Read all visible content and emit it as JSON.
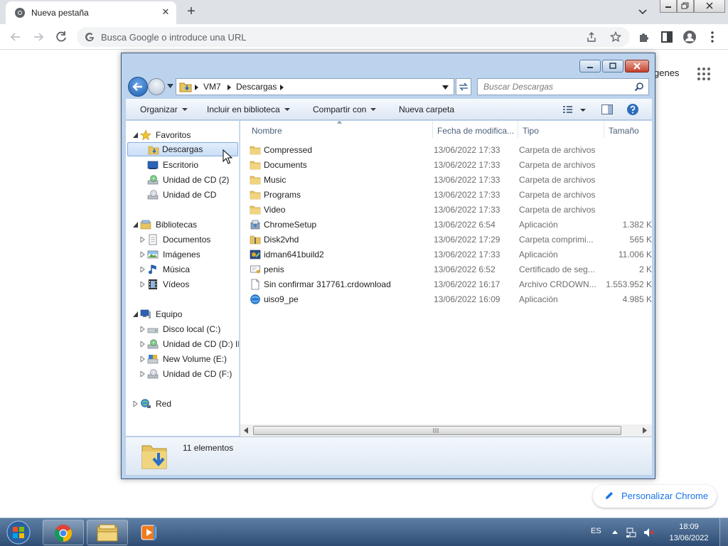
{
  "chrome": {
    "tab_title": "Nueva pestaña",
    "tab_close": "✕",
    "new_tab": "+",
    "omnibox_placeholder": "Busca Google o introduce una URL",
    "ntp_images": "genes",
    "customize_label": "Personalizar Chrome",
    "colors": {
      "tabbar": "#dee1e6",
      "accent": "#1a73e8"
    }
  },
  "explorer": {
    "breadcrumb": [
      "VM7",
      "Descargas"
    ],
    "search_placeholder": "Buscar Descargas",
    "commands": [
      {
        "label": "Organizar",
        "dropdown": true
      },
      {
        "label": "Incluir en biblioteca",
        "dropdown": true
      },
      {
        "label": "Compartir con",
        "dropdown": true
      },
      {
        "label": "Nueva carpeta",
        "dropdown": false
      }
    ],
    "nav": {
      "favorites": {
        "label": "Favoritos",
        "items": [
          {
            "label": "Descargas",
            "icon": "downloads-folder-icon",
            "selected": true
          },
          {
            "label": "Escritorio",
            "icon": "desktop-icon"
          },
          {
            "label": "Unidad de CD (2)",
            "icon": "cd-drive-icon"
          },
          {
            "label": "Unidad de CD",
            "icon": "cd-drive-icon"
          }
        ]
      },
      "libraries": {
        "label": "Bibliotecas",
        "items": [
          {
            "label": "Documentos",
            "icon": "documents-icon"
          },
          {
            "label": "Imágenes",
            "icon": "pictures-icon"
          },
          {
            "label": "Música",
            "icon": "music-icon"
          },
          {
            "label": "Vídeos",
            "icon": "videos-icon"
          }
        ]
      },
      "computer": {
        "label": "Equipo",
        "items": [
          {
            "label": "Disco local (C:)",
            "icon": "hard-disk-icon"
          },
          {
            "label": "Unidad de CD (D:) IF",
            "icon": "cd-drive-icon"
          },
          {
            "label": "New Volume (E:)",
            "icon": "volume-icon"
          },
          {
            "label": "Unidad de CD (F:)",
            "icon": "cd-drive-icon"
          }
        ]
      },
      "network": {
        "label": "Red"
      }
    },
    "columns": {
      "name": "Nombre",
      "date": "Fecha de modifica...",
      "type": "Tipo",
      "size": "Tamaño"
    },
    "files": [
      {
        "name": "Compressed",
        "date": "13/06/2022 17:33",
        "type": "Carpeta de archivos",
        "size": "",
        "icon": "folder-icon"
      },
      {
        "name": "Documents",
        "date": "13/06/2022 17:33",
        "type": "Carpeta de archivos",
        "size": "",
        "icon": "folder-icon"
      },
      {
        "name": "Music",
        "date": "13/06/2022 17:33",
        "type": "Carpeta de archivos",
        "size": "",
        "icon": "folder-icon"
      },
      {
        "name": "Programs",
        "date": "13/06/2022 17:33",
        "type": "Carpeta de archivos",
        "size": "",
        "icon": "folder-icon"
      },
      {
        "name": "Video",
        "date": "13/06/2022 17:33",
        "type": "Carpeta de archivos",
        "size": "",
        "icon": "folder-icon"
      },
      {
        "name": "ChromeSetup",
        "date": "13/06/2022 6:54",
        "type": "Aplicación",
        "size": "1.382 K",
        "icon": "installer-icon"
      },
      {
        "name": "Disk2vhd",
        "date": "13/06/2022 17:29",
        "type": "Carpeta comprimi...",
        "size": "565 K",
        "icon": "zip-folder-icon"
      },
      {
        "name": "idman641build2",
        "date": "13/06/2022 17:33",
        "type": "Aplicación",
        "size": "11.006 K",
        "icon": "application-icon"
      },
      {
        "name": "penis",
        "date": "13/06/2022 6:52",
        "type": "Certificado de seg...",
        "size": "2 K",
        "icon": "certificate-icon"
      },
      {
        "name": "Sin confirmar 317761.crdownload",
        "date": "13/06/2022 16:17",
        "type": "Archivo CRDOWN...",
        "size": "1.553.952 K",
        "icon": "file-icon"
      },
      {
        "name": "uiso9_pe",
        "date": "13/06/2022 16:09",
        "type": "Aplicación",
        "size": "4.985 K",
        "icon": "globe-app-icon"
      }
    ],
    "status_count": "11 elementos"
  },
  "taskbar": {
    "language": "ES",
    "time": "18:09",
    "date": "13/06/2022"
  }
}
